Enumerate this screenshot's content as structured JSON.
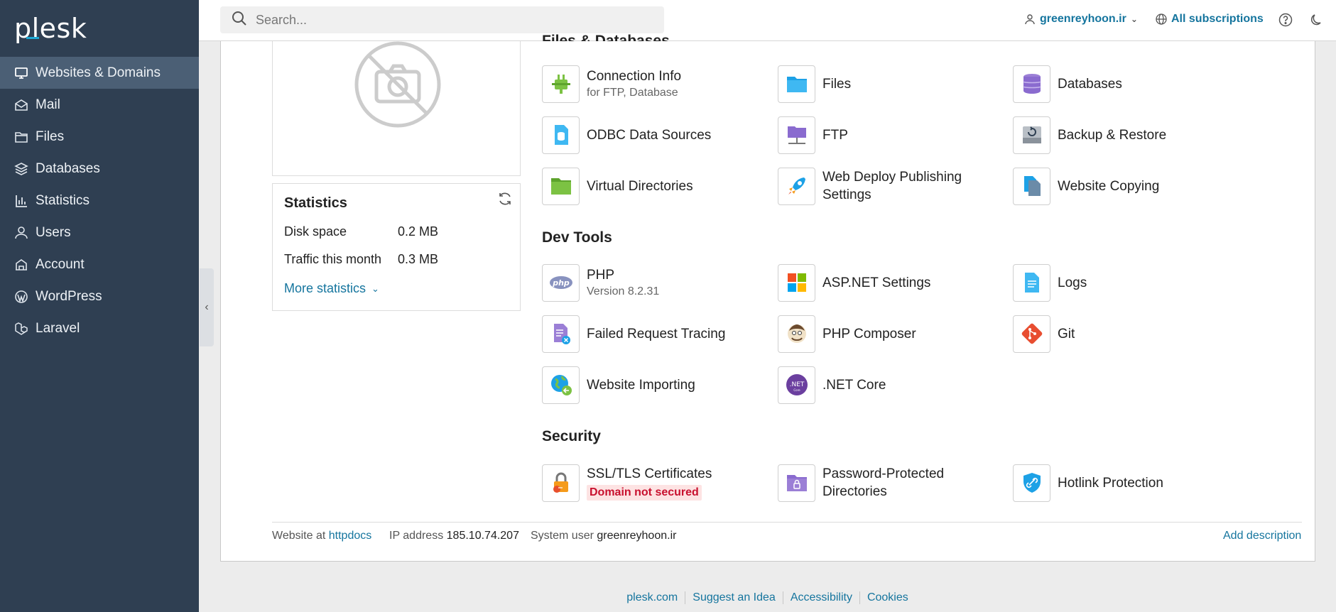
{
  "app": {
    "logo": "plesk"
  },
  "sidebar": {
    "items": [
      {
        "label": "Websites & Domains",
        "icon": "monitor-icon",
        "active": true
      },
      {
        "label": "Mail",
        "icon": "mail-icon"
      },
      {
        "label": "Files",
        "icon": "folder-icon"
      },
      {
        "label": "Databases",
        "icon": "database-icon"
      },
      {
        "label": "Statistics",
        "icon": "bar-chart-icon"
      },
      {
        "label": "Users",
        "icon": "user-icon"
      },
      {
        "label": "Account",
        "icon": "account-icon"
      },
      {
        "label": "WordPress",
        "icon": "wordpress-icon"
      },
      {
        "label": "Laravel",
        "icon": "laravel-icon"
      }
    ]
  },
  "header": {
    "search_placeholder": "Search...",
    "user": "greenreyhoon.ir",
    "subscriptions": "All subscriptions"
  },
  "statistics": {
    "title": "Statistics",
    "disk_label": "Disk space",
    "disk_value": "0.2 MB",
    "traffic_label": "Traffic this month",
    "traffic_value": "0.3 MB",
    "more": "More statistics"
  },
  "sections": {
    "files": "Files & Databases",
    "dev": "Dev Tools",
    "security": "Security"
  },
  "tools": {
    "connection_info": {
      "label": "Connection Info",
      "sub": "for FTP, Database"
    },
    "files": {
      "label": "Files"
    },
    "databases": {
      "label": "Databases"
    },
    "odbc": {
      "label": "ODBC Data Sources"
    },
    "ftp": {
      "label": "FTP"
    },
    "backup": {
      "label": "Backup & Restore"
    },
    "virtual_dirs": {
      "label": "Virtual Directories"
    },
    "web_deploy": {
      "label": "Web Deploy Publishing Settings"
    },
    "website_copying": {
      "label": "Website Copying"
    },
    "php": {
      "label": "PHP",
      "sub": "Version 8.2.31"
    },
    "aspnet": {
      "label": "ASP.NET Settings"
    },
    "logs": {
      "label": "Logs"
    },
    "failed_request": {
      "label": "Failed Request Tracing"
    },
    "php_composer": {
      "label": "PHP Composer"
    },
    "git": {
      "label": "Git"
    },
    "website_importing": {
      "label": "Website Importing"
    },
    "dotnet_core": {
      "label": ".NET Core"
    },
    "ssl": {
      "label": "SSL/TLS Certificates",
      "badge": "Domain not secured"
    },
    "password_dirs": {
      "label": "Password-Protected Directories"
    },
    "hotlink": {
      "label": "Hotlink Protection"
    }
  },
  "site_info": {
    "website_at_label": "Website at",
    "website_at_value": "httpdocs",
    "ip_label": "IP address",
    "ip_value": "185.10.74.207",
    "sysuser_label": "System user",
    "sysuser_value": "greenreyhoon.ir",
    "add_description": "Add description"
  },
  "footer": {
    "links": [
      "plesk.com",
      "Suggest an Idea",
      "Accessibility",
      "Cookies"
    ]
  },
  "colors": {
    "sidebar_bg": "#2f3f52",
    "link": "#15759e",
    "danger": "#c8102e"
  }
}
